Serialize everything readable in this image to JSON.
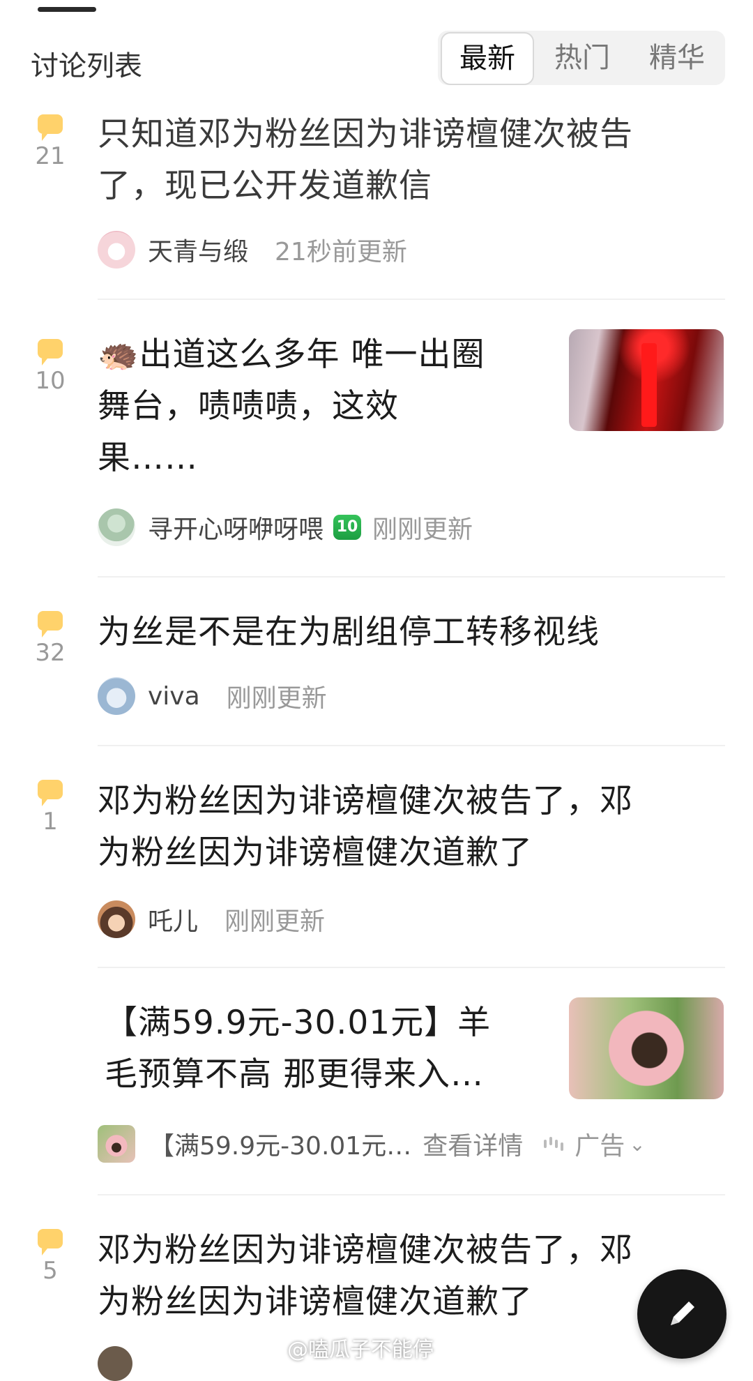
{
  "header": {
    "title": "讨论列表",
    "tabs": [
      {
        "label": "最新",
        "active": true
      },
      {
        "label": "热门",
        "active": false
      },
      {
        "label": "精华",
        "active": false
      }
    ]
  },
  "posts": [
    {
      "comments": "21",
      "title_lines": [
        "只知道邓为粉丝因为诽谤檀健次被告",
        "了，现已公开发道歉信"
      ],
      "user": "天青与缎",
      "time": "21秒前更新"
    },
    {
      "comments": "10",
      "title_lines": [
        "🦔出道这么多年 唯一出圈",
        "舞台，啧啧啧，这效",
        "果……"
      ],
      "user": "寻开心呀咿呀喂",
      "level": "10",
      "time": "刚刚更新"
    },
    {
      "comments": "32",
      "title_lines": [
        "为丝是不是在为剧组停工转移视线"
      ],
      "user": "viva",
      "time": "刚刚更新"
    },
    {
      "comments": "1",
      "title_lines": [
        "邓为粉丝因为诽谤檀健次被告了，邓",
        "为粉丝因为诽谤檀健次道歉了"
      ],
      "user": "吒儿",
      "time": "刚刚更新"
    },
    {
      "comments": "5",
      "title_lines": [
        "邓为粉丝因为诽谤檀健次被告了，邓",
        "为粉丝因为诽谤檀健次道歉了"
      ]
    }
  ],
  "ad": {
    "title_lines": [
      "【满59.9元-30.01元】羊",
      "毛预算不高 那更得来入…"
    ],
    "sub": "【满59.9元-30.01元…",
    "link": "查看详情",
    "tag": "广告"
  },
  "watermark": "@嗑瓜子不能停",
  "icons": {
    "comment": "comment-bubble-icon",
    "compose": "pencil-icon",
    "chevron": "chevron-down-icon"
  },
  "colors": {
    "bubble": "#ffd26b",
    "fab": "#161616",
    "level_badge": "#2bb24c"
  }
}
